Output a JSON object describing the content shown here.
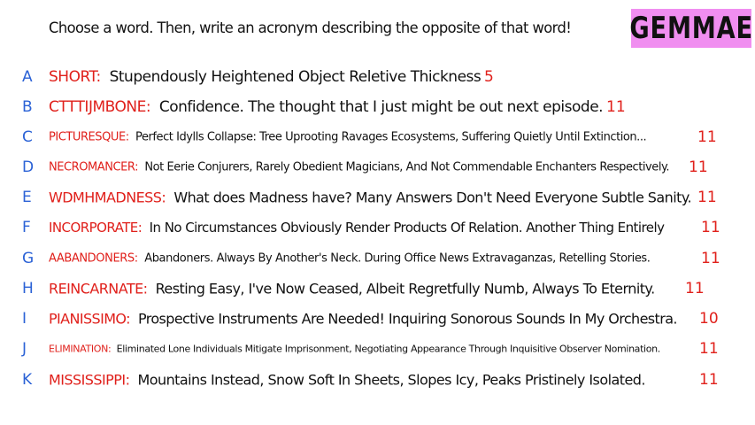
{
  "prompt": "Choose a word. Then, write an acronym describing the opposite of that word!",
  "badge": "GEMMAE",
  "rows": [
    {
      "letter": "A",
      "word": "SHORT",
      "acronym": "Stupendously Heightened Object Reletive Thickness",
      "count": "5"
    },
    {
      "letter": "B",
      "word": "CTTTIJMBONE",
      "acronym": "Confidence. The thought that I just might be out next episode.",
      "count": "11"
    },
    {
      "letter": "C",
      "word": "PICTURESQUE",
      "acronym": "Perfect Idylls Collapse: Tree Uprooting Ravages Ecosystems, Suffering Quietly Until Extinction...",
      "count": "11"
    },
    {
      "letter": "D",
      "word": "NECROMANCER",
      "acronym": "Not Eerie Conjurers, Rarely Obedient Magicians, And Not Commendable Enchanters Respectively.",
      "count": "11"
    },
    {
      "letter": "E",
      "word": "WDMHMADNESS",
      "acronym": "What does Madness have? Many Answers Don't Need Everyone Subtle Sanity.",
      "count": "11"
    },
    {
      "letter": "F",
      "word": "INCORPORATE",
      "acronym": "In No Circumstances Obviously Render Products Of Relation. Another Thing Entirely",
      "count": "11"
    },
    {
      "letter": "G",
      "word": "AABANDONERS",
      "acronym": "Abandoners. Always By Another's Neck. During Office News Extravaganzas, Retelling Stories.",
      "count": "11"
    },
    {
      "letter": "H",
      "word": "REINCARNATE",
      "acronym": "Resting Easy, I've Now Ceased, Albeit Regretfully Numb, Always To Eternity.",
      "count": "11"
    },
    {
      "letter": "I",
      "word": "PIANISSIMO",
      "acronym": "Prospective Instruments Are Needed! Inquiring Sonorous Sounds In My Orchestra.",
      "count": "10"
    },
    {
      "letter": "J",
      "word": "ELIMINATION",
      "acronym": "Eliminated Lone Individuals Mitigate Imprisonment, Negotiating Appearance Through Inquisitive Observer Nomination.",
      "count": "11"
    },
    {
      "letter": "K",
      "word": "MISSISSIPPI",
      "acronym": "Mountains Instead, Snow Soft In Sheets, Slopes Icy, Peaks Pristinely Isolated.",
      "count": "11"
    }
  ],
  "colors": {
    "letter": "#2b62d6",
    "word": "#e0201b",
    "count": "#e0201b",
    "badge_bg": "#f08ef0",
    "text": "#111111"
  }
}
